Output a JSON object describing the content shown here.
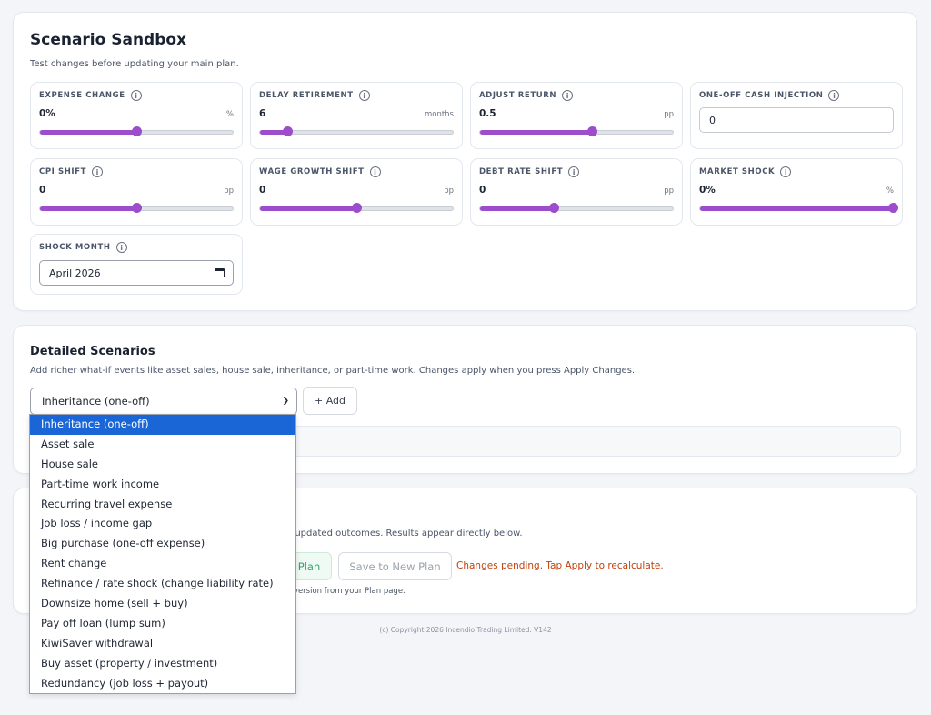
{
  "sandbox": {
    "title": "Scenario Sandbox",
    "subtitle": "Test changes before updating your main plan.",
    "info_glyph": "i",
    "controls": {
      "expense": {
        "label": "EXPENSE CHANGE",
        "value": "0%",
        "unit": "%",
        "level": 0.5
      },
      "delay": {
        "label": "DELAY RETIREMENT",
        "value": "6",
        "unit": "months",
        "level": 0.14
      },
      "return": {
        "label": "ADJUST RETURN",
        "value": "0.5",
        "unit": "pp",
        "level": 0.58
      },
      "cash": {
        "label": "ONE-OFF CASH INJECTION",
        "value": "0"
      },
      "cpi": {
        "label": "CPI SHIFT",
        "value": "0",
        "unit": "pp",
        "level": 0.5
      },
      "wage": {
        "label": "WAGE GROWTH SHIFT",
        "value": "0",
        "unit": "pp",
        "level": 0.5
      },
      "debt": {
        "label": "DEBT RATE SHIFT",
        "value": "0",
        "unit": "pp",
        "level": 0.38
      },
      "market": {
        "label": "MARKET SHOCK",
        "value": "0%",
        "unit": "%",
        "level": 1.0
      },
      "shock_month": {
        "label": "SHOCK MONTH",
        "value": "April 2026"
      }
    }
  },
  "detailed": {
    "title": "Detailed Scenarios",
    "subtitle": "Add richer what-if events like asset sales, house sale, inheritance, or part-time work. Changes apply when you press Apply Changes.",
    "selected": "Inheritance (one-off)",
    "add_label": "+ Add",
    "options": [
      "Inheritance (one-off)",
      "Asset sale",
      "House sale",
      "Part-time work income",
      "Recurring travel expense",
      "Job loss / income gap",
      "Big purchase (one-off expense)",
      "Rent change",
      "Refinance / rate shock (change liability rate)",
      "Downsize home (sell + buy)",
      "Pay off loan (lump sum)",
      "KiwiSaver withdrawal",
      "Buy asset (property / investment)",
      "Redundancy (job loss + payout)"
    ]
  },
  "apply": {
    "desc_visible": "e updated outcomes. Results appear directly below.",
    "apply_label_visible": "Plan",
    "save_label": "Save to New Plan",
    "pending": "Changes pending. Tap Apply to recalculate.",
    "note_visible": "a version from your Plan page."
  },
  "footer": "(c) Copyright 2026 Incendio Trading Limited. V142",
  "colors": {
    "accent": "#9c4dcc",
    "selected_option": "#1a66d6",
    "pending": "#c2410c",
    "apply_green": "#38a06b"
  }
}
